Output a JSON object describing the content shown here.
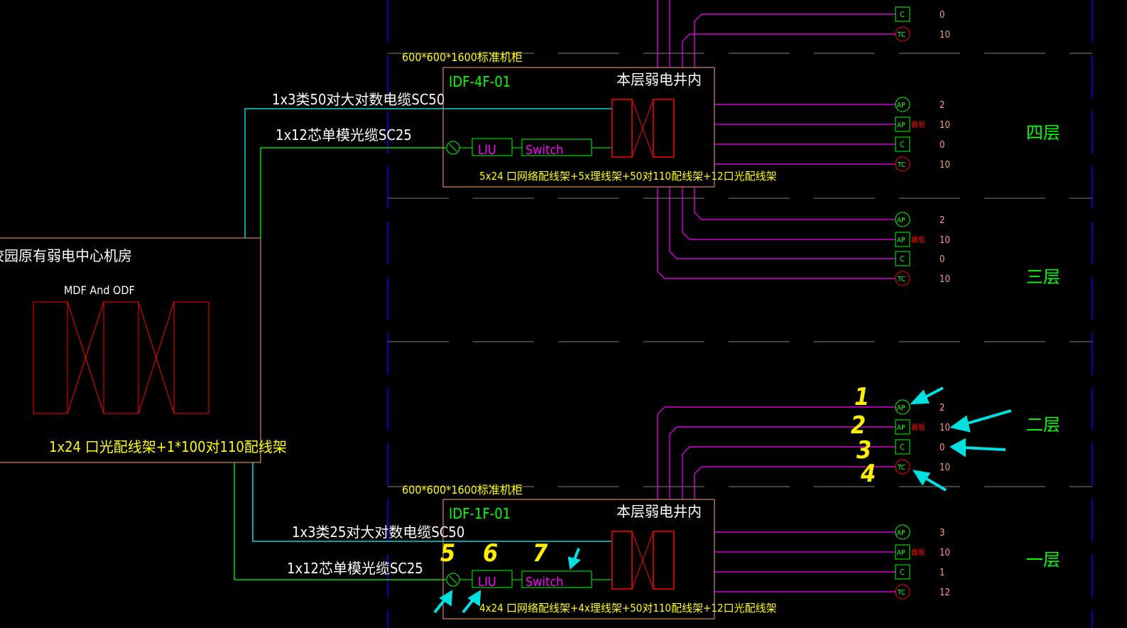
{
  "colors": {
    "cable_copper": "#00ffff",
    "cable_fiber": "#00ff00",
    "horizontal": "#ff00ff",
    "frame": "#ff0000",
    "box": "#ffa080",
    "text": "#ffff00",
    "grid": "#808080",
    "axis": "#0000ff"
  },
  "center": {
    "title": "校园原有弱电中心机房",
    "mdf_odf": "MDF  And  ODF",
    "equipment": "1x24 口光配线架+1*100对110配线架"
  },
  "cabinet_label": "600*600*1600标准机柜",
  "idf_top": {
    "name": "IDF-4F-01",
    "location": "本层弱电井内",
    "liu": "LIU",
    "switch": "Switch",
    "equipment": "5x24 口网络配线架+5x理线架+50对110配线架+12口光配线架",
    "copper_cable": "1x3类50对大对数电缆SC50",
    "fiber_cable": "1x12芯单模光缆SC25"
  },
  "idf_bottom": {
    "name": "IDF-1F-01",
    "location": "本层弱电井内",
    "liu": "LIU",
    "switch": "Switch",
    "equipment": "4x24 口网络配线架+4x理线架+50对110配线架+12口光配线架",
    "copper_cable": "1x3类25对大对数电缆SC50",
    "fiber_cable": "1x12芯单模光缆SC25"
  },
  "ap_note": "面板",
  "floors": [
    {
      "label": "",
      "outlets": [
        {
          "type": "C",
          "count": "0"
        },
        {
          "type": "TC",
          "count": "10"
        }
      ]
    },
    {
      "label": "四层",
      "outlets": [
        {
          "type": "AP",
          "count": "2"
        },
        {
          "type": "AP-panel",
          "count": "10"
        },
        {
          "type": "C",
          "count": "0"
        },
        {
          "type": "TC",
          "count": "10"
        }
      ]
    },
    {
      "label": "三层",
      "outlets": [
        {
          "type": "AP",
          "count": "2"
        },
        {
          "type": "AP-panel",
          "count": "10"
        },
        {
          "type": "C",
          "count": "0"
        },
        {
          "type": "TC",
          "count": "10"
        }
      ]
    },
    {
      "label": "二层",
      "outlets": [
        {
          "type": "AP",
          "count": "2"
        },
        {
          "type": "AP-panel",
          "count": "10"
        },
        {
          "type": "C",
          "count": "0"
        },
        {
          "type": "TC",
          "count": "10"
        }
      ]
    },
    {
      "label": "一层",
      "outlets": [
        {
          "type": "AP",
          "count": "3"
        },
        {
          "type": "AP-panel",
          "count": "10"
        },
        {
          "type": "C",
          "count": "1"
        },
        {
          "type": "TC",
          "count": "12"
        }
      ]
    }
  ],
  "annotations": [
    "1",
    "2",
    "3",
    "4",
    "5",
    "6",
    "7"
  ]
}
